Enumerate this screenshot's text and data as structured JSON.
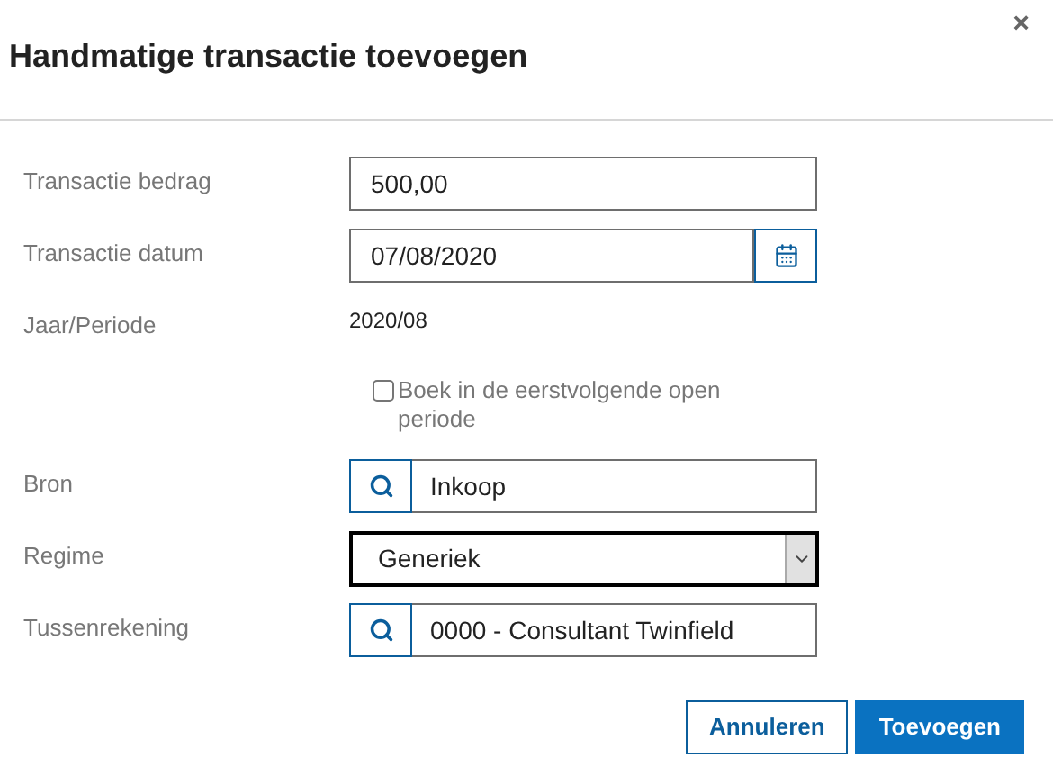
{
  "dialog": {
    "title": "Handmatige transactie toevoegen",
    "close": "×"
  },
  "fields": [
    {
      "kind": "text",
      "label": "Transactie bedrag",
      "value": "500,00"
    },
    {
      "kind": "date",
      "label": "Transactie datum",
      "value": "07/08/2020"
    },
    {
      "kind": "static",
      "label": "Jaar/Periode",
      "value": "2020/08"
    },
    {
      "kind": "checkbox",
      "label": "Boek in de eerstvolgende open periode",
      "checked": false
    },
    {
      "kind": "lookup",
      "label": "Bron",
      "value": "Inkoop"
    },
    {
      "kind": "select",
      "label": "Regime",
      "value": "Generiek"
    },
    {
      "kind": "lookup",
      "label": "Tussenrekening",
      "value": "0000 - Consultant Twinfield"
    }
  ],
  "buttons": [
    {
      "label": "Annuleren",
      "kind": "secondary"
    },
    {
      "label": "Toevoegen",
      "kind": "primary"
    }
  ]
}
